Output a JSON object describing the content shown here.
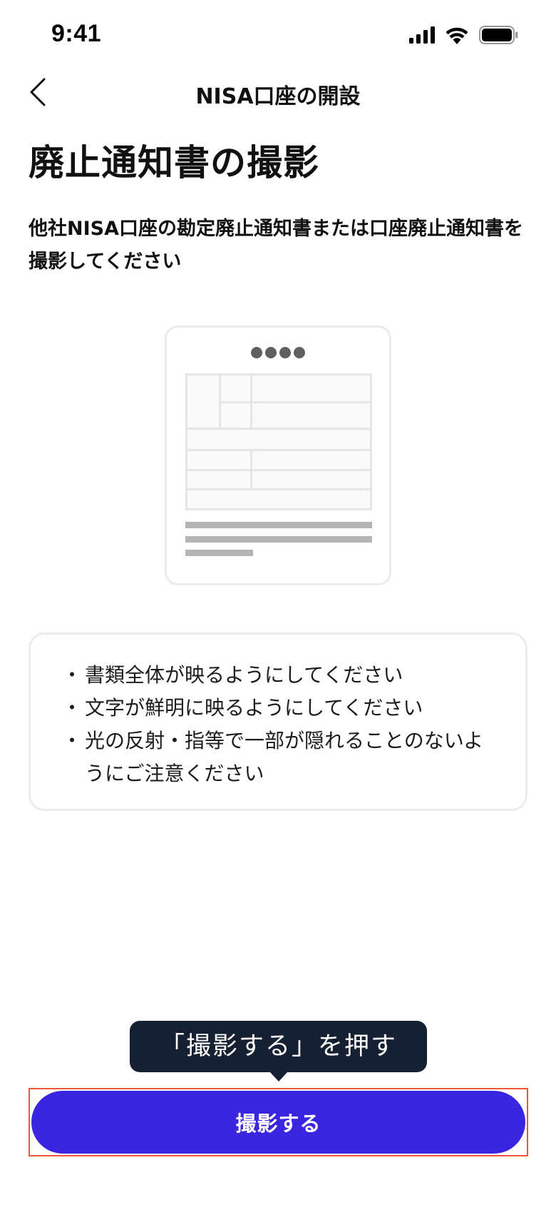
{
  "status_bar": {
    "time": "9:41"
  },
  "nav": {
    "title": "NISA口座の開設"
  },
  "page": {
    "title": "廃止通知書の撮影",
    "description": "他社NISA口座の勘定廃止通知書または口座廃止通知書を撮影してください"
  },
  "tips": {
    "bullet": "・",
    "items": [
      "書類全体が映るようにしてください",
      "文字が鮮明に映るようにしてください",
      "光の反射・指等で一部が隠れることのないようにご注意ください"
    ]
  },
  "tooltip": {
    "text": "「撮影する」を押す"
  },
  "capture_button": {
    "label": "撮影する"
  },
  "colors": {
    "primary": "#3a26e1",
    "tooltip_bg": "#162033",
    "highlight": "#ee5440"
  }
}
